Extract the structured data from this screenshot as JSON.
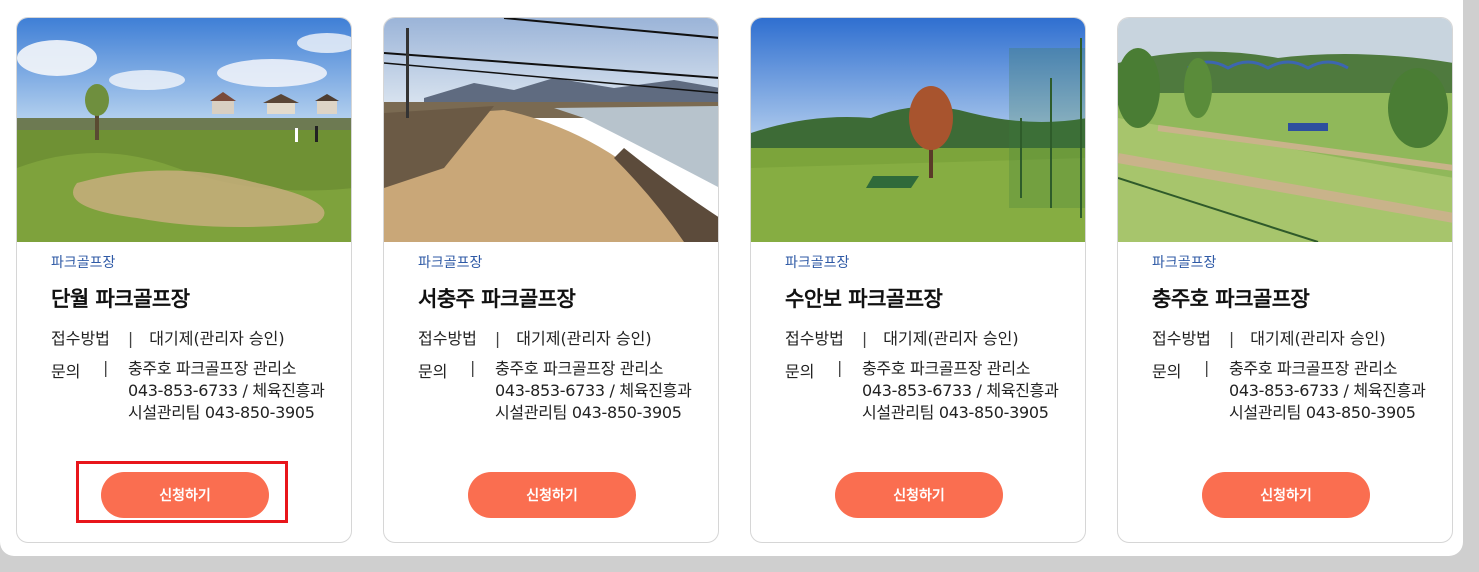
{
  "cards": [
    {
      "category": "파크골프장",
      "title": "단월 파크골프장",
      "method_label": "접수방법",
      "method_value": "대기제(관리자 승인)",
      "contact_label": "문의",
      "contact_value": "충주호 파크골프장 관리소 043-853-6733 / 체육진흥과 시설관리팀 043-850-3905",
      "button": "신청하기",
      "photo": "park-golf-danwol"
    },
    {
      "category": "파크골프장",
      "title": "서충주 파크골프장",
      "method_label": "접수방법",
      "method_value": "대기제(관리자 승인)",
      "contact_label": "문의",
      "contact_value": "충주호 파크골프장 관리소 043-853-6733 / 체육진흥과 시설관리팀 043-850-3905",
      "button": "신청하기",
      "photo": "park-golf-seochungju"
    },
    {
      "category": "파크골프장",
      "title": "수안보 파크골프장",
      "method_label": "접수방법",
      "method_value": "대기제(관리자 승인)",
      "contact_label": "문의",
      "contact_value": "충주호 파크골프장 관리소 043-853-6733 / 체육진흥과 시설관리팀 043-850-3905",
      "button": "신청하기",
      "photo": "park-golf-suanbo"
    },
    {
      "category": "파크골프장",
      "title": "충주호 파크골프장",
      "method_label": "접수방법",
      "method_value": "대기제(관리자 승인)",
      "contact_label": "문의",
      "contact_value": "충주호 파크골프장 관리소 043-853-6733 / 체육진흥과 시설관리팀 043-850-3905",
      "button": "신청하기",
      "photo": "park-golf-chungjuho"
    }
  ],
  "colors": {
    "accent": "#fa6e50",
    "category": "#2f5aa6",
    "highlight": "#e8161b"
  }
}
